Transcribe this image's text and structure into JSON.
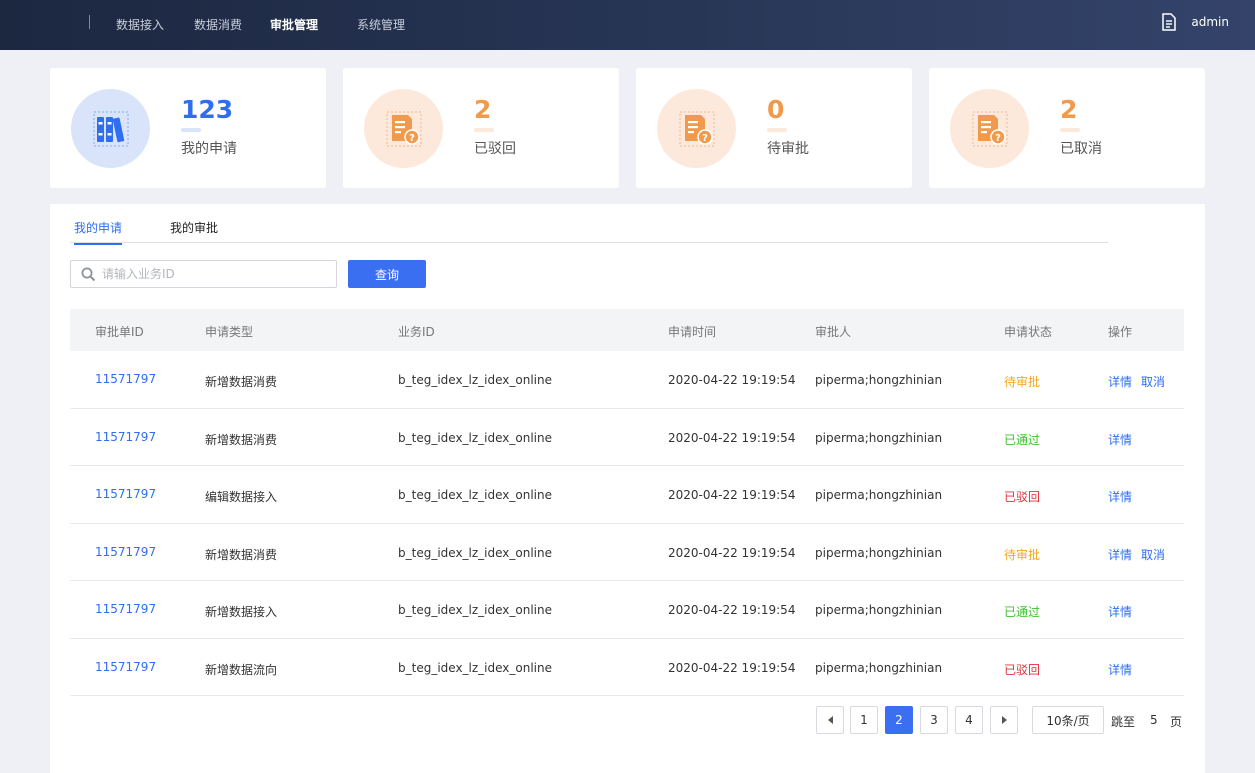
{
  "nav": {
    "items": [
      {
        "label": "数据接入",
        "active": false
      },
      {
        "label": "数据消费",
        "active": false
      },
      {
        "label": "审批管理",
        "active": true
      },
      {
        "label": "系统管理",
        "active": false
      }
    ],
    "user": "admin"
  },
  "stats": [
    {
      "value": "123",
      "label": "我的申请",
      "icon": "binders-icon",
      "color": "#2f6ef0"
    },
    {
      "value": "2",
      "label": "已驳回",
      "icon": "pending-doc-icon",
      "color": "#f09a4e"
    },
    {
      "value": "0",
      "label": "待审批",
      "icon": "pending-doc-icon",
      "color": "#f09a4e"
    },
    {
      "value": "2",
      "label": "已取消",
      "icon": "pending-doc-icon",
      "color": "#f09a4e"
    }
  ],
  "tabs": [
    {
      "label": "我的申请",
      "active": true
    },
    {
      "label": "我的审批",
      "active": false
    }
  ],
  "search": {
    "placeholder": "请输入业务ID",
    "value": "",
    "button": "查询"
  },
  "table": {
    "headers": [
      "审批单ID",
      "申请类型",
      "业务ID",
      "申请时间",
      "审批人",
      "申请状态",
      "操作"
    ],
    "rows": [
      {
        "id": "11571797",
        "type": "新增数据消费",
        "biz": "b_teg_idex_lz_idex_online",
        "time": "2020-04-22 19:19:54",
        "approver": "piperma;hongzhinian",
        "status": "待审批",
        "status_color": "#f5a623",
        "actions": [
          "详情",
          "取消"
        ]
      },
      {
        "id": "11571797",
        "type": "新增数据消费",
        "biz": "b_teg_idex_lz_idex_online",
        "time": "2020-04-22 19:19:54",
        "approver": "piperma;hongzhinian",
        "status": "已通过",
        "status_color": "#3cc22f",
        "actions": [
          "详情"
        ]
      },
      {
        "id": "11571797",
        "type": "编辑数据接入",
        "biz": "b_teg_idex_lz_idex_online",
        "time": "2020-04-22 19:19:54",
        "approver": "piperma;hongzhinian",
        "status": "已驳回",
        "status_color": "#e0303a",
        "actions": [
          "详情"
        ]
      },
      {
        "id": "11571797",
        "type": "新增数据消费",
        "biz": "b_teg_idex_lz_idex_online",
        "time": "2020-04-22 19:19:54",
        "approver": "piperma;hongzhinian",
        "status": "待审批",
        "status_color": "#f5a623",
        "actions": [
          "详情",
          "取消"
        ]
      },
      {
        "id": "11571797",
        "type": "新增数据接入",
        "biz": "b_teg_idex_lz_idex_online",
        "time": "2020-04-22 19:19:54",
        "approver": "piperma;hongzhinian",
        "status": "已通过",
        "status_color": "#3cc22f",
        "actions": [
          "详情"
        ]
      },
      {
        "id": "11571797",
        "type": "新增数据流向",
        "biz": "b_teg_idex_lz_idex_online",
        "time": "2020-04-22 19:19:54",
        "approver": "piperma;hongzhinian",
        "status": "已驳回",
        "status_color": "#e0303a",
        "actions": [
          "详情"
        ]
      }
    ]
  },
  "pagination": {
    "pages": [
      "1",
      "2",
      "3",
      "4"
    ],
    "current": "2",
    "page_size": "10条/页",
    "jump_label": "跳至",
    "jump_value": "5",
    "page_suffix": "页"
  }
}
